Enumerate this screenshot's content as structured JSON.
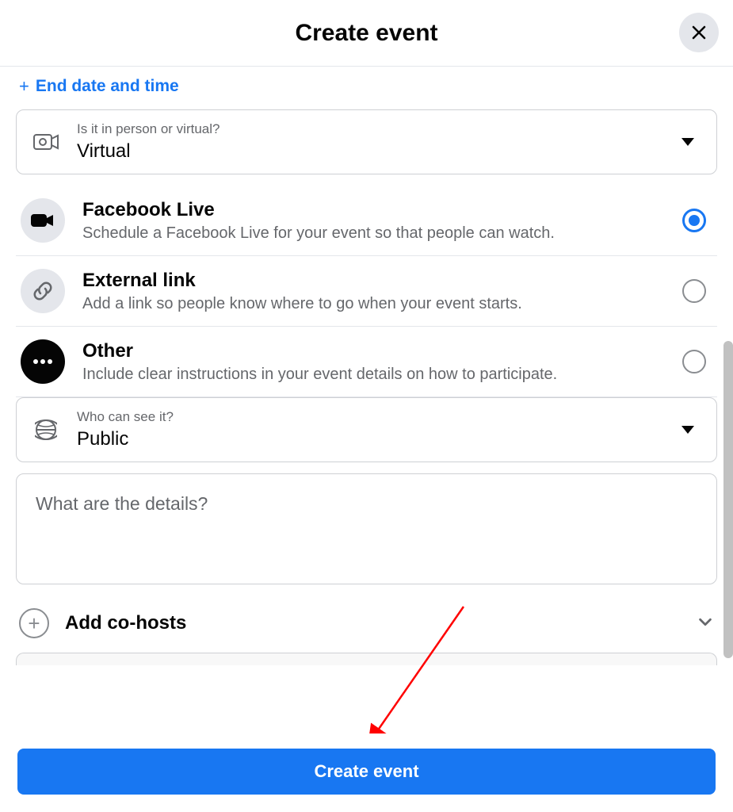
{
  "header": {
    "title": "Create event"
  },
  "endDate": {
    "label": "End date and time"
  },
  "locationSelect": {
    "label": "Is it in person or virtual?",
    "value": "Virtual"
  },
  "virtualOptions": [
    {
      "title": "Facebook Live",
      "desc": "Schedule a Facebook Live for your event so that people can watch.",
      "selected": true,
      "icon": "camera"
    },
    {
      "title": "External link",
      "desc": "Add a link so people know where to go when your event starts.",
      "selected": false,
      "icon": "link"
    },
    {
      "title": "Other",
      "desc": "Include clear instructions in your event details on how to participate.",
      "selected": false,
      "icon": "dots"
    }
  ],
  "privacySelect": {
    "label": "Who can see it?",
    "value": "Public"
  },
  "details": {
    "placeholder": "What are the details?"
  },
  "cohosts": {
    "label": "Add co-hosts"
  },
  "footer": {
    "createLabel": "Create event"
  }
}
